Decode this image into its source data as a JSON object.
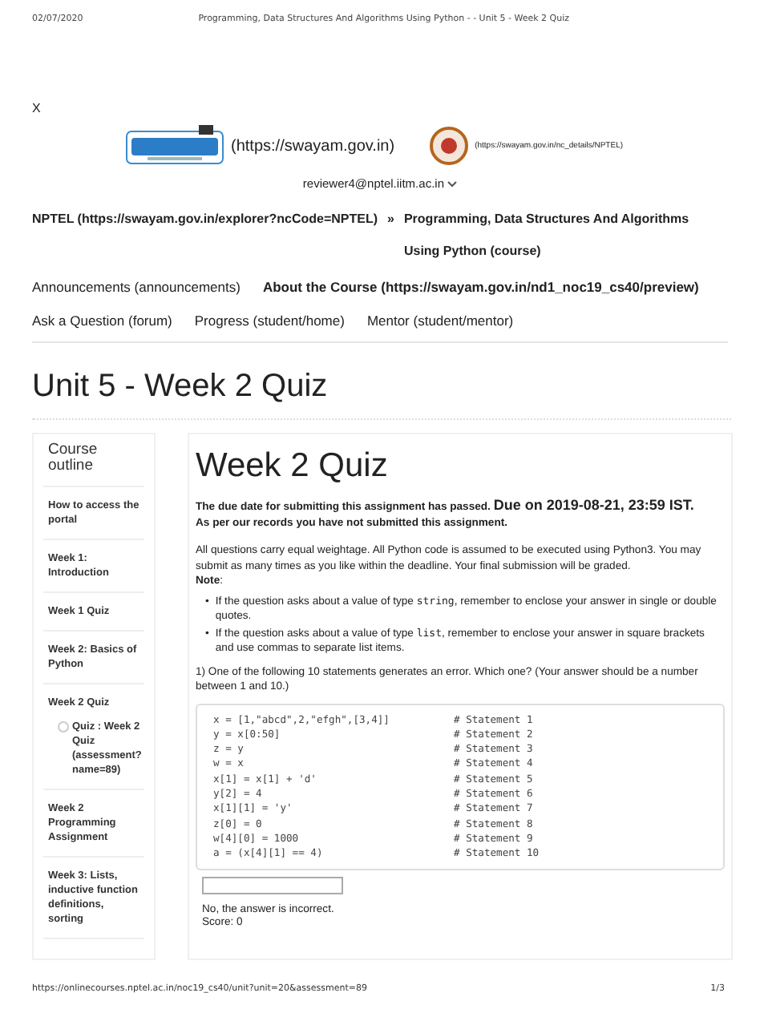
{
  "print_header": {
    "date": "02/07/2020",
    "title": "Programming, Data Structures And Algorithms Using Python - - Unit 5 - Week 2 Quiz"
  },
  "close": "X",
  "logos": {
    "swayam_link": "(https://swayam.gov.in)",
    "nptel_link": "(https://swayam.gov.in/nc_details/NPTEL)"
  },
  "user": "reviewer4@nptel.iitm.ac.in",
  "breadcrumb": [
    "NPTEL (https://swayam.gov.in/explorer?ncCode=NPTEL)",
    "Programming, Data Structures And Algorithms Using Python (course)"
  ],
  "breadcrumb_separator": "»",
  "nav": [
    {
      "label": "Announcements (announcements)",
      "bold": false
    },
    {
      "label": "About the Course (https://swayam.gov.in/nd1_noc19_cs40/preview)",
      "bold": true
    },
    {
      "label": "Ask a Question (forum)",
      "bold": false
    },
    {
      "label": "Progress (student/home)",
      "bold": false
    },
    {
      "label": "Mentor (student/mentor)",
      "bold": false
    }
  ],
  "page_title": "Unit 5 - Week 2 Quiz",
  "sidebar": {
    "title": "Course outline",
    "items": [
      {
        "label": "How to access the portal"
      },
      {
        "label": "Week 1: Introduction"
      },
      {
        "label": "Week 1 Quiz"
      },
      {
        "label": "Week 2: Basics of Python"
      },
      {
        "label": "Week 2 Quiz",
        "children": [
          {
            "label": "Quiz : Week 2 Quiz (assessment?name=89)"
          }
        ]
      },
      {
        "label": "Week 2 Programming Assignment"
      },
      {
        "label": "Week 3: Lists, inductive function definitions, sorting"
      }
    ]
  },
  "quiz": {
    "title": "Week 2 Quiz",
    "passed_notice": "The due date for submitting this assignment has passed.",
    "due": "Due on 2019-08-21, 23:59 IST.",
    "not_submitted": "As per our records you have not submitted this assignment.",
    "intro": "All questions carry equal weightage. All Python code is assumed to be executed using Python3. You may submit as many times as you like within the deadline. Your final submission will be graded.",
    "note_label": "Note",
    "note_colon": ":",
    "notes": [
      {
        "bullet": "•",
        "before": "If the question asks about a value of type ",
        "code": "string",
        "after": ", remember to enclose your answer in single or double quotes."
      },
      {
        "bullet": "•",
        "before": "If the question asks about a value of type ",
        "code": "list",
        "after": ", remember to enclose your answer in square brackets and use commas to separate list items."
      }
    ],
    "question": "1) One of the following 10 statements generates an error. Which one? (Your answer should be a number between 1 and 10.)",
    "code": [
      {
        "code": "x = [1,\"abcd\",2,\"efgh\",[3,4]]",
        "comment": "# Statement 1"
      },
      {
        "code": "y = x[0:50]",
        "comment": "# Statement 2"
      },
      {
        "code": "z = y",
        "comment": "# Statement 3"
      },
      {
        "code": "w = x",
        "comment": "# Statement 4"
      },
      {
        "code": "x[1] = x[1] + 'd'",
        "comment": "# Statement 5"
      },
      {
        "code": "y[2] = 4",
        "comment": "# Statement 6"
      },
      {
        "code": "x[1][1] = 'y'",
        "comment": "# Statement 7"
      },
      {
        "code": "z[0] = 0",
        "comment": "# Statement 8"
      },
      {
        "code": "w[4][0] = 1000",
        "comment": "# Statement 9"
      },
      {
        "code": "a = (x[4][1] == 4)",
        "comment": "# Statement 10"
      }
    ],
    "feedback": "No, the answer is incorrect.",
    "score": "Score: 0"
  },
  "print_footer": {
    "url": "https://onlinecourses.nptel.ac.in/noc19_cs40/unit?unit=20&assessment=89",
    "page": "1/3"
  }
}
